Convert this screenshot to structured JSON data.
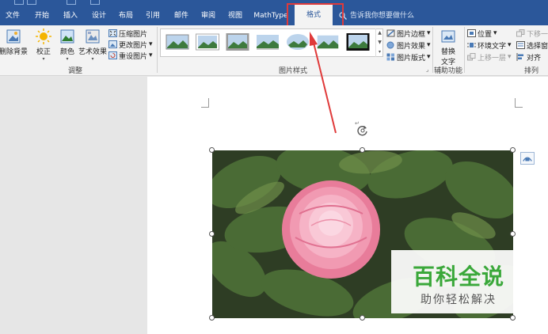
{
  "tabs": [
    "文件",
    "开始",
    "插入",
    "设计",
    "布局",
    "引用",
    "邮件",
    "审阅",
    "视图",
    "MathType",
    "格式"
  ],
  "active_tab": "格式",
  "tell_me": "告诉我你想要做什么",
  "ribbon": {
    "adjust": {
      "remove_bg": "删除背景",
      "corrections": "校正",
      "color": "颜色",
      "artistic": "艺术效果",
      "compress": "压缩图片",
      "change": "更改图片",
      "reset": "重设图片",
      "group_label": "调整"
    },
    "styles": {
      "border": "图片边框",
      "effects": "图片效果",
      "layout": "图片版式",
      "group_label": "图片样式"
    },
    "accessibility": {
      "alt_text_line1": "替换",
      "alt_text_line2": "文字",
      "group_label": "辅助功能"
    },
    "arrange": {
      "position": "位置",
      "wrap": "环境文字",
      "forward": "上移一层",
      "backward": "下移一",
      "selection": "选择窗格",
      "align": "对齐",
      "group_label": "排列"
    }
  },
  "watermark": {
    "title": "百科全说",
    "subtitle": "助你轻松解决"
  },
  "colors": {
    "tabbar": "#2b579a",
    "ribbon": "#f3f3f3",
    "highlight": "#e03a3a",
    "watermark_green": "#3aa83a"
  }
}
